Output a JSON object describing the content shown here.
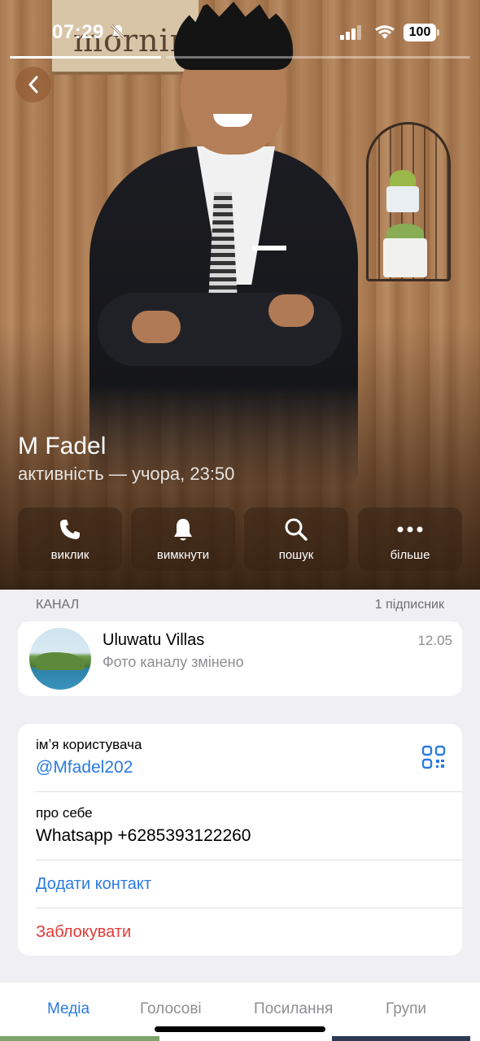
{
  "status_bar": {
    "time": "07:29",
    "battery": "100"
  },
  "hero": {
    "sign_text": "morning",
    "name": "M Fadel",
    "last_seen": "активність — учора, 23:50"
  },
  "actions": [
    {
      "label": "виклик",
      "icon": "phone-icon"
    },
    {
      "label": "вимкнути",
      "icon": "bell-icon"
    },
    {
      "label": "пошук",
      "icon": "search-icon"
    },
    {
      "label": "більше",
      "icon": "more-icon"
    }
  ],
  "channel_section": {
    "title": "КАНАЛ",
    "subscribers": "1 підписник",
    "channel": {
      "name": "Uluwatu Villas",
      "last_message": "Фото каналу змінено",
      "date": "12.05"
    }
  },
  "info": {
    "username_label": "імʼя користувача",
    "username": "@Mfadel202",
    "bio_label": "про себе",
    "bio": "Whatsapp +6285393122260",
    "add_contact": "Додати контакт",
    "block": "Заблокувати"
  },
  "tabs": {
    "items": [
      "Медіа",
      "Голосові",
      "Посилання",
      "Групи"
    ],
    "active": "Медіа"
  },
  "colors": {
    "accent": "#2a7ae2",
    "danger": "#e53935",
    "background": "#efeff4"
  }
}
